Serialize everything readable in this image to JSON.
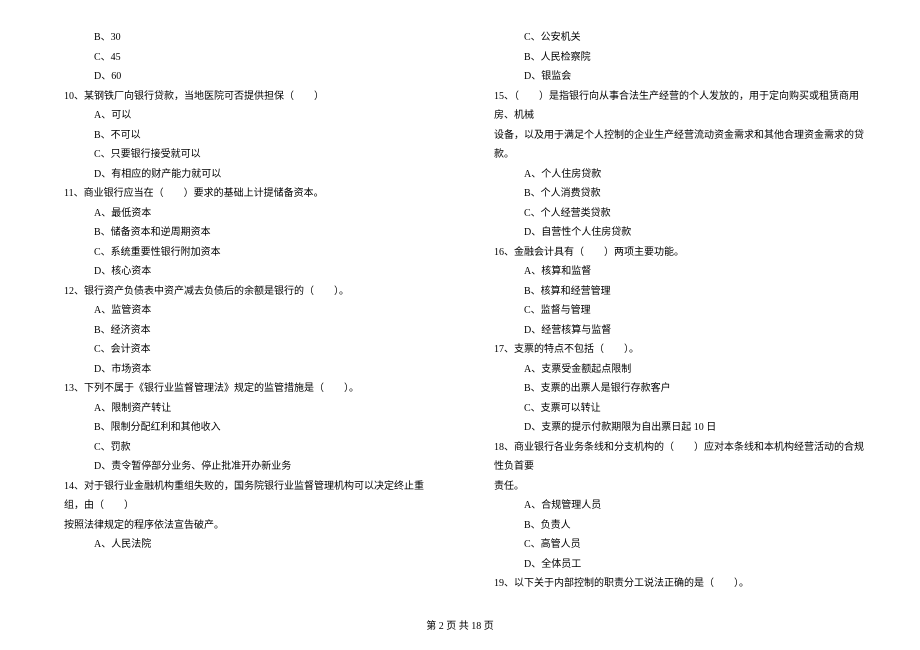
{
  "left": {
    "opts_pre": [
      "B、30",
      "C、45",
      "D、60"
    ],
    "q10": "10、某钢铁厂向银行贷款，当地医院可否提供担保（　　）",
    "q10_opts": [
      "A、可以",
      "B、不可以",
      "C、只要银行接受就可以",
      "D、有相应的财产能力就可以"
    ],
    "q11": "11、商业银行应当在（　　）要求的基础上计提储备资本。",
    "q11_opts": [
      "A、最低资本",
      "B、储备资本和逆周期资本",
      "C、系统重要性银行附加资本",
      "D、核心资本"
    ],
    "q12": "12、银行资产负债表中资产减去负债后的余额是银行的（　　）。",
    "q12_opts": [
      "A、监管资本",
      "B、经济资本",
      "C、会计资本",
      "D、市场资本"
    ],
    "q13": "13、下列不属于《银行业监督管理法》规定的监管措施是（　　）。",
    "q13_opts": [
      "A、限制资产转让",
      "B、限制分配红利和其他收入",
      "C、罚款",
      "D、责令暂停部分业务、停止批准开办新业务"
    ],
    "q14a": "14、对于银行业金融机构重组失败的，国务院银行业监督管理机构可以决定终止重组，由（　　）",
    "q14b": "按照法律规定的程序依法宣告破产。",
    "q14_opts": [
      "A、人民法院"
    ]
  },
  "right": {
    "opts_pre": [
      "C、公安机关",
      "B、人民检察院",
      "D、银监会"
    ],
    "q15a": "15、（　　）是指银行向从事合法生产经营的个人发放的，用于定向购买或租赁商用房、机械",
    "q15b": "设备，以及用于满足个人控制的企业生产经营流动资金需求和其他合理资金需求的贷款。",
    "q15_opts": [
      "A、个人住房贷款",
      "B、个人消费贷款",
      "C、个人经营类贷款",
      "D、自营性个人住房贷款"
    ],
    "q16": "16、金融会计具有（　　）两项主要功能。",
    "q16_opts": [
      "A、核算和监督",
      "B、核算和经营管理",
      "C、监督与管理",
      "D、经营核算与监督"
    ],
    "q17": "17、支票的特点不包括（　　）。",
    "q17_opts": [
      "A、支票受金额起点限制",
      "B、支票的出票人是银行存款客户",
      "C、支票可以转让",
      "D、支票的提示付款期限为自出票日起 10 日"
    ],
    "q18a": "18、商业银行各业务条线和分支机构的（　　）应对本条线和本机构经营活动的合规性负首要",
    "q18b": "责任。",
    "q18_opts": [
      "A、合规管理人员",
      "B、负责人",
      "C、高管人员",
      "D、全体员工"
    ],
    "q19": "19、以下关于内部控制的职责分工说法正确的是（　　）。"
  },
  "footer": "第 2 页 共 18 页"
}
